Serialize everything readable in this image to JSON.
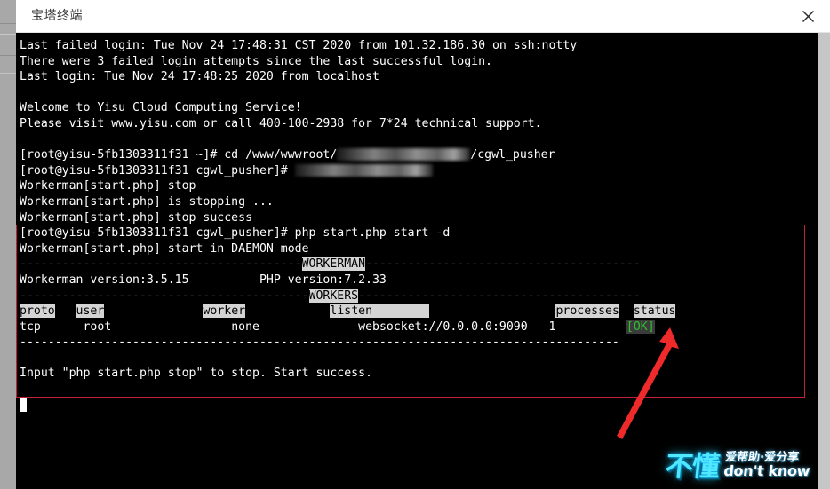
{
  "window": {
    "title": "宝塔终端",
    "close_label": "×",
    "close_icon": "close-icon"
  },
  "terminal": {
    "prompt_host": "[root@yisu-5fb1303311f31",
    "lines": [
      {
        "type": "text",
        "text": "Last failed login: Tue Nov 24 17:48:31 CST 2020 from 101.32.186.30 on ssh:notty"
      },
      {
        "type": "text",
        "text": "There were 3 failed login attempts since the last successful login."
      },
      {
        "type": "text",
        "text": "Last login: Tue Nov 24 17:48:25 2020 from localhost"
      },
      {
        "type": "blank",
        "text": ""
      },
      {
        "type": "text",
        "text": "Welcome to Yisu Cloud Computing Service!"
      },
      {
        "type": "text",
        "text": "Please visit www.yisu.com or call 400-100-2938 for 7*24 technical support."
      },
      {
        "type": "blank",
        "text": ""
      },
      {
        "type": "cmd_redacted_path",
        "prefix": "[root@yisu-5fb1303311f31 ~]# cd /www/wwwroot/",
        "suffix": "/cgwl_pusher"
      },
      {
        "type": "cmd_redacted_tail",
        "prefix": "[root@yisu-5fb1303311f31 cgwl_pusher]# ",
        "suffix": ""
      },
      {
        "type": "text",
        "text": "Workerman[start.php] stop"
      },
      {
        "type": "text",
        "text": "Workerman[start.php] is stopping ..."
      },
      {
        "type": "text",
        "text": "Workerman[start.php] stop success"
      },
      {
        "type": "text",
        "text": "[root@yisu-5fb1303311f31 cgwl_pusher]# php start.php start -d"
      },
      {
        "type": "text",
        "text": "Workerman[start.php] start in DAEMON mode"
      }
    ],
    "banner": {
      "workerman_dash_left": "----------------------------------------",
      "workerman_label": "WORKERMAN",
      "workerman_dash_right": "---------------------------------------",
      "version_line": "Workerman version:3.5.15          PHP version:7.2.33",
      "workerman_version": "3.5.15",
      "php_version": "7.2.33",
      "workers_dash_left": "-----------------------------------------",
      "workers_label": "WORKERS",
      "workers_dash_right": "----------------------------------------",
      "bottom_dash": "-------------------------------------------------------------------------------------"
    },
    "table": {
      "columns": [
        "proto",
        "user",
        "worker",
        "listen",
        "processes",
        "status"
      ],
      "rows": [
        {
          "proto": "tcp",
          "user": "root",
          "worker": "none",
          "listen": "websocket://0.0.0.0:9090",
          "processes": "1",
          "status": "[OK]"
        }
      ]
    },
    "footer_line": "Input \"php start.php stop\" to stop. Start success.",
    "cursor": "block"
  },
  "annotation": {
    "arrow_color": "#ee2a2a",
    "box_color": "#c0223a",
    "arrow_target": "status-ok-cell"
  },
  "watermark": {
    "mark": "不懂",
    "tagline_cn": "爱帮助·爱分享",
    "tagline_en": "don't know",
    "color": "#4fe8ff"
  }
}
